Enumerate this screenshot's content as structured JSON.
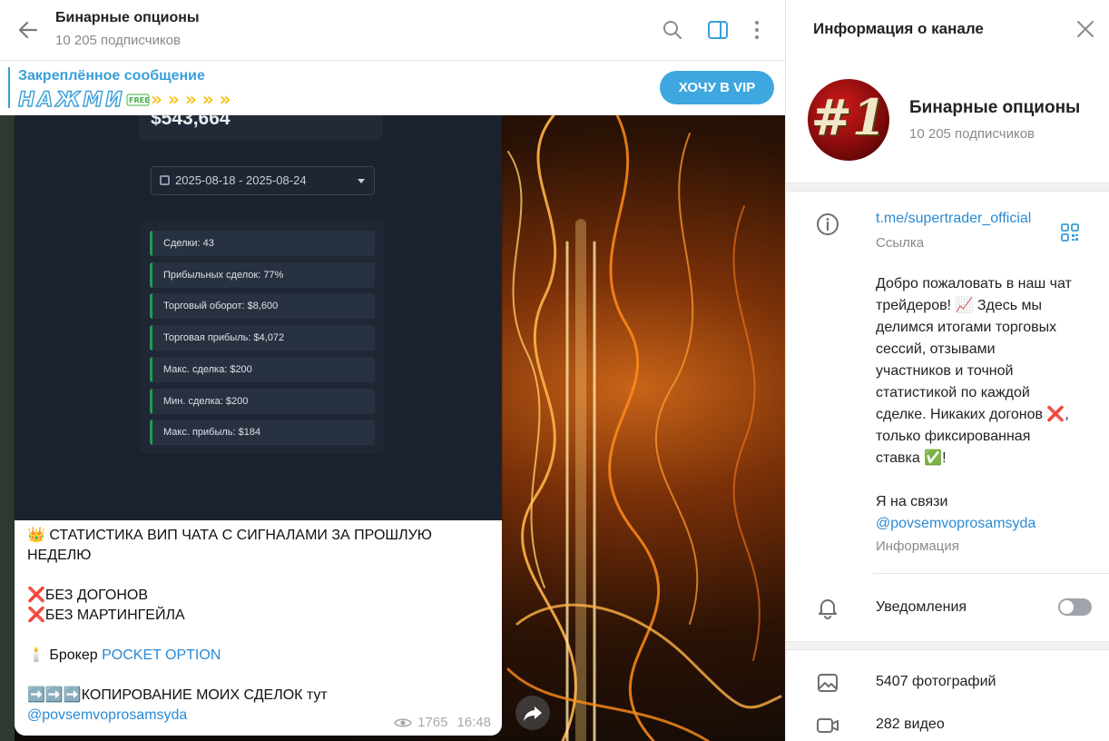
{
  "header": {
    "title": "Бинарные опционы",
    "subtitle": "10 205 подписчиков"
  },
  "pinned": {
    "title": "Закреплённое сообщение",
    "preview_text": "НАЖМИ",
    "preview_badge": "FREE",
    "preview_arrows": "»»»»»",
    "button_label": "ХОЧУ В VIP"
  },
  "message": {
    "screenshot": {
      "amount": "$543,664",
      "date_range": "2025-08-18 - 2025-08-24",
      "stats": [
        "Сделки: 43",
        "Прибыльных сделок: 77%",
        "Торговый оборот: $8,600",
        "Торговая прибыль: $4,072",
        "Макс. сделка: $200",
        "Мин. сделка: $200",
        "Макс. прибыль: $184"
      ]
    },
    "caption": {
      "line1_emoji": "👑",
      "line1": "СТАТИСТИКА  ВИП ЧАТА С СИГНАЛАМИ ЗА ПРОШЛУЮ НЕДЕЛЮ",
      "line2_emoji": "❌",
      "line2": "БЕЗ ДОГОНОВ",
      "line3_emoji": "❌",
      "line3": "БЕЗ МАРТИНГЕЙЛА",
      "broker_emoji": "🕯️",
      "broker_prefix": "Брокер ",
      "broker_link": "POCKET OPTION",
      "copy_emoji": "➡️➡️➡️",
      "copy_text": "КОПИРОВАНИЕ МОИХ СДЕЛОК  тут",
      "mention": "@povsemvoprosamsyda"
    },
    "views": "1765",
    "time": "16:48"
  },
  "info_panel": {
    "heading": "Информация о канале",
    "avatar_text": "#1",
    "channel_name": "Бинарные опционы",
    "subscribers": "10 205 подписчиков",
    "link": "t.me/supertrader_official",
    "link_label": "Ссылка",
    "description_lines": [
      "Добро пожаловать в наш чат",
      "трейдеров! 📈 Здесь мы",
      "делимся итогами торговых",
      "сессий, отзывами",
      "участников и точной",
      "статистикой по каждой",
      "сделке. Никаких догонов ❌,",
      "только фиксированная",
      "ставка ✅!"
    ],
    "contact_text": "Я на связи",
    "contact_mention": "@povsemvoprosamsyda",
    "description_label": "Информация",
    "notifications_label": "Уведомления",
    "notifications_enabled": false,
    "media": [
      {
        "label": "5407 фотографий",
        "icon": "photo-icon"
      },
      {
        "label": "282 видео",
        "icon": "video-icon"
      }
    ]
  },
  "colors": {
    "accent": "#3a9fd8",
    "link": "#2a8ad4",
    "vip_button": "#3fa7df",
    "stat_border": "#1f9d55"
  }
}
